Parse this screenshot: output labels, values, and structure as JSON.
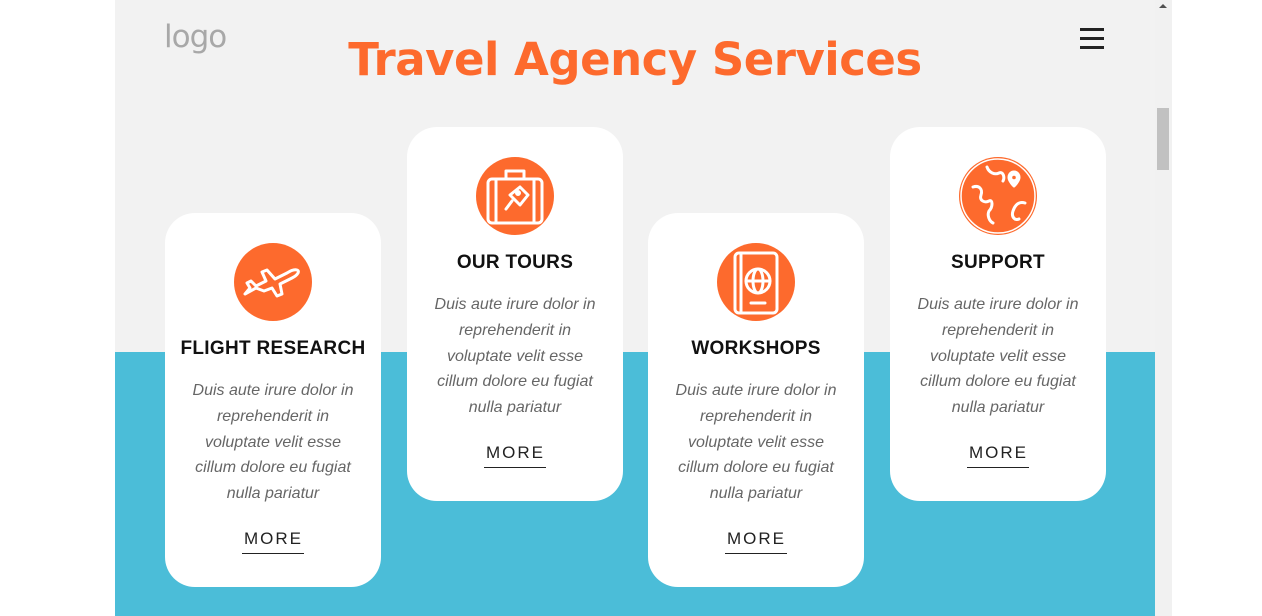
{
  "header": {
    "logo_text": "logo",
    "title": "Travel Agency Services",
    "menu_icon": "hamburger-menu-icon"
  },
  "colors": {
    "accent": "#fd6a2d",
    "band": "#4bbdd8",
    "page_bg": "#f2f2f2",
    "card_bg": "#ffffff"
  },
  "cards": [
    {
      "title": "FLIGHT RESEARCH",
      "icon": "airplane-icon",
      "text": "Duis aute irure dolor in reprehenderit in voluptate velit esse cillum dolore eu fugiat nulla pariatur",
      "more_label": "MORE"
    },
    {
      "title": "OUR TOURS",
      "icon": "suitcase-icon",
      "text": "Duis aute irure dolor in reprehenderit in voluptate velit esse cillum dolore eu fugiat nulla pariatur",
      "more_label": "MORE"
    },
    {
      "title": "WORKSHOPS",
      "icon": "passport-icon",
      "text": "Duis aute irure dolor in reprehenderit in voluptate velit esse cillum dolore eu fugiat nulla pariatur",
      "more_label": "MORE"
    },
    {
      "title": "SUPPORT",
      "icon": "globe-pin-icon",
      "text": "Duis aute irure dolor in reprehenderit in voluptate velit esse cillum dolore eu fugiat nulla pariatur",
      "more_label": "MORE"
    }
  ]
}
